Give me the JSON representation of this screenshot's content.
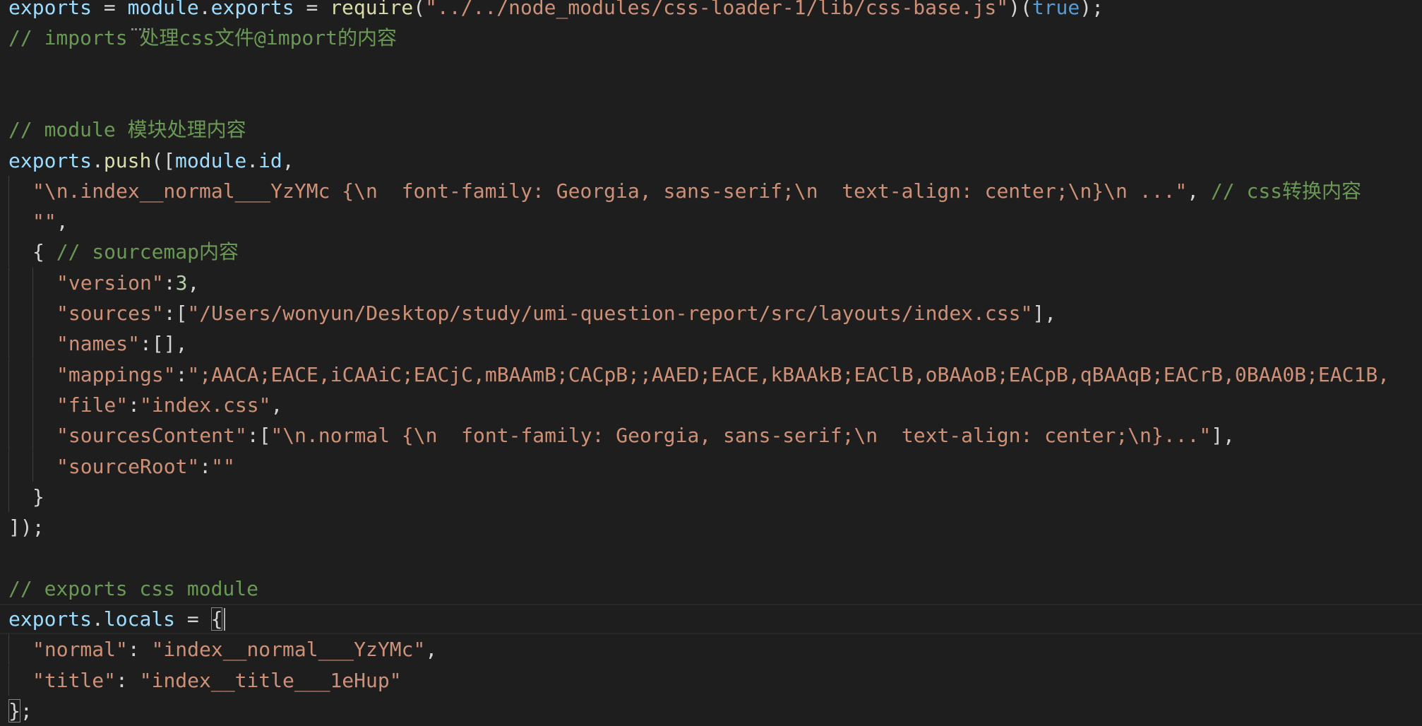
{
  "editor": {
    "lines": [
      {
        "indent": 0,
        "tokens": [
          {
            "t": "exports",
            "c": "var"
          },
          {
            "t": " = ",
            "c": "pun"
          },
          {
            "t": "module",
            "c": "var"
          },
          {
            "t": ".",
            "c": "pun"
          },
          {
            "t": "exports",
            "c": "var"
          },
          {
            "t": " = ",
            "c": "pun"
          },
          {
            "t": "require",
            "c": "fn"
          },
          {
            "t": "(",
            "c": "pun"
          },
          {
            "t": "\"../../node_modules/css-loader-1/lib/css-base.js\"",
            "c": "str"
          },
          {
            "t": ")(",
            "c": "pun"
          },
          {
            "t": "true",
            "c": "kw"
          },
          {
            "t": ");",
            "c": "pun"
          }
        ]
      },
      {
        "indent": 0,
        "tokens": [
          {
            "t": "// imports 处理css文件@import的内容",
            "c": "cmt"
          }
        ]
      },
      {
        "indent": 0,
        "tokens": []
      },
      {
        "indent": 0,
        "tokens": []
      },
      {
        "indent": 0,
        "tokens": [
          {
            "t": "// module 模块处理内容",
            "c": "cmt"
          }
        ]
      },
      {
        "indent": 0,
        "tokens": [
          {
            "t": "exports",
            "c": "var"
          },
          {
            "t": ".",
            "c": "pun"
          },
          {
            "t": "push",
            "c": "fn"
          },
          {
            "t": "([",
            "c": "pun"
          },
          {
            "t": "module",
            "c": "var"
          },
          {
            "t": ".",
            "c": "pun"
          },
          {
            "t": "id",
            "c": "var"
          },
          {
            "t": ",",
            "c": "pun"
          }
        ]
      },
      {
        "indent": 1,
        "tokens": [
          {
            "t": "\"\\n.index__normal___YzYMc {\\n  font-family: Georgia, sans-serif;\\n  text-align: center;\\n}\\n ...\"",
            "c": "str"
          },
          {
            "t": ", ",
            "c": "pun"
          },
          {
            "t": "// css转换内容",
            "c": "cmt"
          }
        ]
      },
      {
        "indent": 1,
        "tokens": [
          {
            "t": "\"\"",
            "c": "str"
          },
          {
            "t": ",",
            "c": "pun"
          }
        ]
      },
      {
        "indent": 1,
        "tokens": [
          {
            "t": "{ ",
            "c": "pun"
          },
          {
            "t": "// sourcemap内容",
            "c": "cmt"
          }
        ]
      },
      {
        "indent": 2,
        "tokens": [
          {
            "t": "\"version\"",
            "c": "str"
          },
          {
            "t": ":",
            "c": "pun"
          },
          {
            "t": "3",
            "c": "num"
          },
          {
            "t": ",",
            "c": "pun"
          }
        ]
      },
      {
        "indent": 2,
        "tokens": [
          {
            "t": "\"sources\"",
            "c": "str"
          },
          {
            "t": ":[",
            "c": "pun"
          },
          {
            "t": "\"/Users/wonyun/Desktop/study/umi-question-report/src/layouts/index.css\"",
            "c": "str"
          },
          {
            "t": "],",
            "c": "pun"
          }
        ]
      },
      {
        "indent": 2,
        "tokens": [
          {
            "t": "\"names\"",
            "c": "str"
          },
          {
            "t": ":[],",
            "c": "pun"
          }
        ]
      },
      {
        "indent": 2,
        "tokens": [
          {
            "t": "\"mappings\"",
            "c": "str"
          },
          {
            "t": ":",
            "c": "pun"
          },
          {
            "t": "\";AACA;EACE,iCAAiC;EACjC,mBAAmB;CACpB;;AAED;EACE,kBAAkB;EAClB,oBAAoB;EACpB,qBAAqB;EACrB,0BAA0B;EAC1B,",
            "c": "str"
          }
        ]
      },
      {
        "indent": 2,
        "tokens": [
          {
            "t": "\"file\"",
            "c": "str"
          },
          {
            "t": ":",
            "c": "pun"
          },
          {
            "t": "\"index.css\"",
            "c": "str"
          },
          {
            "t": ",",
            "c": "pun"
          }
        ]
      },
      {
        "indent": 2,
        "tokens": [
          {
            "t": "\"sourcesContent\"",
            "c": "str"
          },
          {
            "t": ":[",
            "c": "pun"
          },
          {
            "t": "\"\\n.normal {\\n  font-family: Georgia, sans-serif;\\n  text-align: center;\\n}...\"",
            "c": "str"
          },
          {
            "t": "],",
            "c": "pun"
          }
        ]
      },
      {
        "indent": 2,
        "tokens": [
          {
            "t": "\"sourceRoot\"",
            "c": "str"
          },
          {
            "t": ":",
            "c": "pun"
          },
          {
            "t": "\"\"",
            "c": "str"
          }
        ]
      },
      {
        "indent": 1,
        "tokens": [
          {
            "t": "}",
            "c": "pun"
          }
        ]
      },
      {
        "indent": 0,
        "tokens": [
          {
            "t": "]);",
            "c": "pun"
          }
        ]
      },
      {
        "indent": 0,
        "tokens": []
      },
      {
        "indent": 0,
        "tokens": [
          {
            "t": "// exports css module",
            "c": "cmt"
          }
        ]
      },
      {
        "indent": 0,
        "current": true,
        "tokens": [
          {
            "t": "exports",
            "c": "var"
          },
          {
            "t": ".",
            "c": "pun"
          },
          {
            "t": "locals",
            "c": "var"
          },
          {
            "t": " = ",
            "c": "pun"
          },
          {
            "t": "{",
            "c": "pun",
            "match": true
          }
        ]
      },
      {
        "indent": 1,
        "tokens": [
          {
            "t": "\"normal\"",
            "c": "str"
          },
          {
            "t": ": ",
            "c": "pun"
          },
          {
            "t": "\"index__normal___YzYMc\"",
            "c": "str"
          },
          {
            "t": ",",
            "c": "pun"
          }
        ]
      },
      {
        "indent": 1,
        "tokens": [
          {
            "t": "\"title\"",
            "c": "str"
          },
          {
            "t": ": ",
            "c": "pun"
          },
          {
            "t": "\"index__title___1eHup\"",
            "c": "str"
          }
        ]
      },
      {
        "indent": 0,
        "tokens": [
          {
            "t": "}",
            "c": "pun",
            "match": true
          },
          {
            "t": ";",
            "c": "pun"
          }
        ]
      }
    ]
  }
}
